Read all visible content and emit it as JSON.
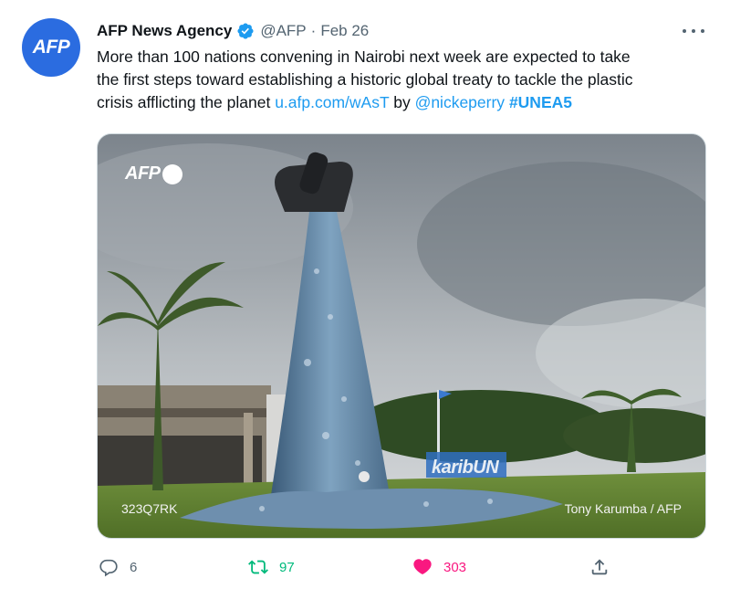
{
  "tweet": {
    "avatar_text": "AFP",
    "author_name": "AFP News Agency",
    "handle": "@AFP",
    "separator": "·",
    "date": "Feb 26",
    "text_main": "More than 100 nations convening in Nairobi next week are expected to take\nthe first steps toward establishing a historic global treaty to tackle the plastic\ncrisis afflicting the planet ",
    "link": "u.afp.com/wAsT",
    "by_text": " by ",
    "mention": "@nickeperry",
    "space": " ",
    "hashtag": "#UNEA5",
    "photo": {
      "watermark": "AFP",
      "code": "323Q7RK",
      "credit": "Tony Karumba / AFP",
      "sign": "karibUN"
    },
    "stats": {
      "replies": "6",
      "retweets": "97",
      "likes": "303"
    },
    "colors": {
      "avatar": "#2b6ce0",
      "verified": "#1d9bf0",
      "link": "#1d9bf0",
      "retweet": "#00ba7c",
      "like": "#f91880"
    },
    "icons": {
      "more": "more-dots-icon",
      "verified": "verified-badge-icon",
      "reply": "reply-bubble-icon",
      "retweet": "retweet-icon",
      "like": "heart-icon",
      "share": "share-icon"
    }
  }
}
